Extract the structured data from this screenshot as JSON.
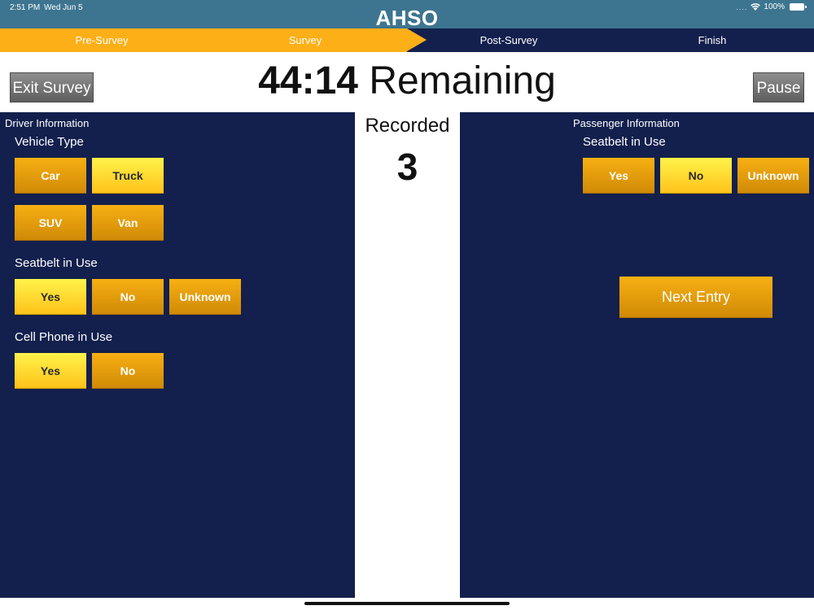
{
  "status_bar": {
    "time": "2:51 PM",
    "date": "Wed Jun 5",
    "signal": "....",
    "battery": "100%"
  },
  "app_title": "AHSO",
  "steps": [
    "Pre-Survey",
    "Survey",
    "Post-Survey",
    "Finish"
  ],
  "steps_completed_fraction": 0.5,
  "timer": {
    "value": "44:14",
    "suffix": "Remaining"
  },
  "buttons": {
    "exit": "Exit Survey",
    "pause": "Pause",
    "next_entry": "Next Entry"
  },
  "recorded": {
    "label": "Recorded",
    "count": "3"
  },
  "driver": {
    "title": "Driver Information",
    "vehicle_type": {
      "label": "Vehicle Type",
      "options": [
        "Car",
        "Truck",
        "SUV",
        "Van"
      ],
      "selected": "Truck"
    },
    "seatbelt": {
      "label": "Seatbelt in Use",
      "options": [
        "Yes",
        "No",
        "Unknown"
      ],
      "selected": "Yes"
    },
    "cell_phone": {
      "label": "Cell Phone in Use",
      "options": [
        "Yes",
        "No"
      ],
      "selected": "Yes"
    }
  },
  "passenger": {
    "title": "Passenger Information",
    "seatbelt": {
      "label": "Seatbelt in Use",
      "options": [
        "Yes",
        "No",
        "Unknown"
      ],
      "selected": "No"
    }
  },
  "colors": {
    "header": "#3d7590",
    "navy": "#13204d",
    "accent": "#fcaf17",
    "selected": "#ffd21f"
  }
}
